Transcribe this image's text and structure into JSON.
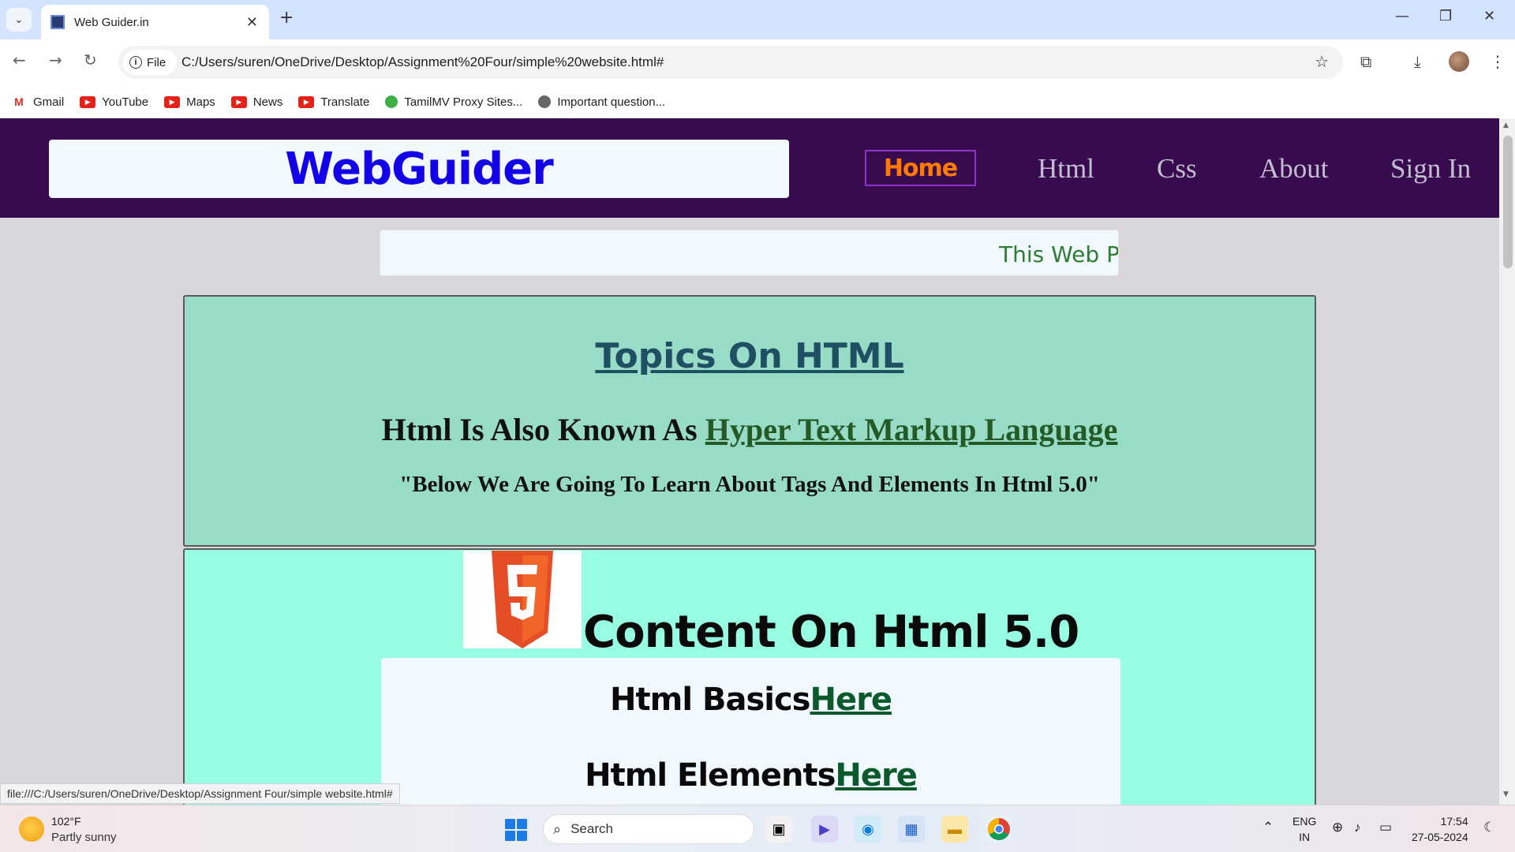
{
  "browser": {
    "tab_title": "Web Guider.in",
    "url_chip": "File",
    "url": "C:/Users/suren/OneDrive/Desktop/Assignment%20Four/simple%20website.html#",
    "bookmarks": [
      "Gmail",
      "YouTube",
      "Maps",
      "News",
      "Translate",
      "TamilMV Proxy Sites...",
      "Important question..."
    ],
    "status_url": "file:///C:/Users/suren/OneDrive/Desktop/Assignment Four/simple website.html#"
  },
  "site": {
    "logo": "WebGuider",
    "nav": [
      "Home",
      "Html",
      "Css",
      "About",
      "Sign In"
    ],
    "marquee": "This Web Pa",
    "topics_title": "Topics On HTML",
    "topics_sub_prefix": "Html Is Also Known As ",
    "topics_sub_link": "Hyper Text Markup Language",
    "topics_quote": "\"Below We Are Going To Learn About Tags And Elements In Html 5.0\"",
    "content_title": "Content On Html 5.0",
    "content_items": [
      {
        "label": "Html Basics",
        "link": "Here"
      },
      {
        "label": "Html Elements",
        "link": "Here"
      }
    ]
  },
  "taskbar": {
    "weather_temp": "102°F",
    "weather_desc": "Partly sunny",
    "search_placeholder": "Search",
    "lang_line1": "ENG",
    "lang_line2": "IN",
    "time": "17:54",
    "date": "27-05-2024"
  },
  "colors": {
    "header_bg": "#380b4e",
    "logo_color": "#1300e8",
    "home_color": "#ff7a00",
    "topics_bg": "#98dbc6",
    "content_bg": "#96fde3"
  }
}
